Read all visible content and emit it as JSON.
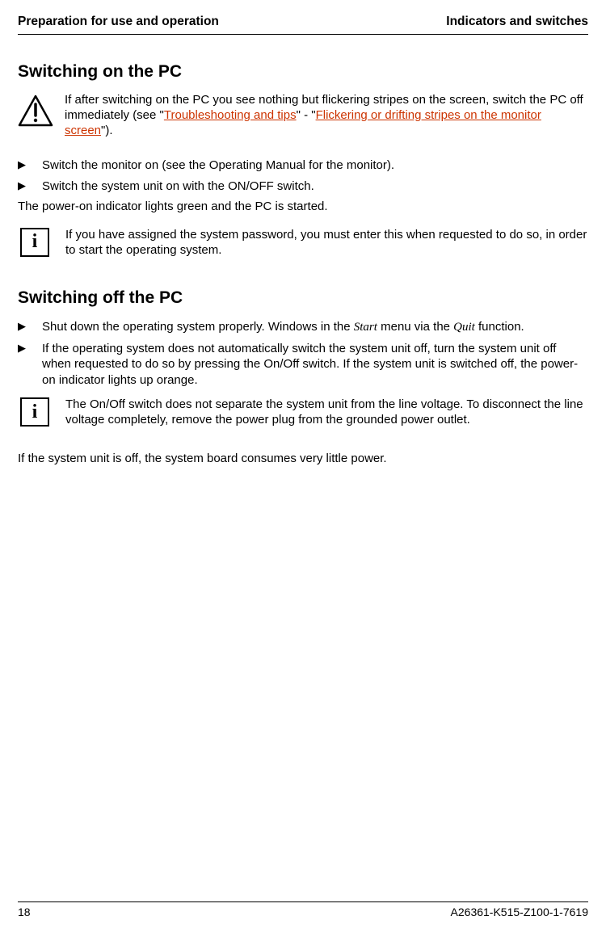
{
  "header": {
    "left": "Preparation for use and operation",
    "right": "Indicators and switches"
  },
  "section1": {
    "title": "Switching on the PC",
    "warning": {
      "pre": "If after switching on the PC you see nothing but flickering stripes on the screen, switch the PC off immediately (see \"",
      "link1": "Troubleshooting and tips",
      "mid": "\" - \"",
      "link2": "Flickering or drifting stripes on the monitor screen",
      "post": "\")."
    },
    "bullets": [
      "Switch the monitor on (see the Operating Manual for the monitor).",
      "Switch the system unit on with the ON/OFF switch."
    ],
    "para": "The power-on indicator lights green and the PC is started.",
    "info": "If you have assigned the system password, you must enter this when requested to do so, in order to start the operating system."
  },
  "section2": {
    "title": "Switching off the PC",
    "bullets": [
      {
        "pre": "Shut down the operating system properly. Windows in the ",
        "ital1": "Start",
        "mid": " menu via the ",
        "ital2": "Quit",
        "post": " function."
      },
      {
        "text": "If the operating system does not automatically switch the system unit off, turn the system unit off when requested to do so by pressing the On/Off switch. If the system unit is switched off, the power-on indicator lights up orange."
      }
    ],
    "info": "The On/Off switch does not separate the system unit from the line voltage. To disconnect the line voltage completely, remove the power plug from the grounded power outlet.",
    "para": "If the system unit is off, the system board consumes very little power."
  },
  "footer": {
    "page": "18",
    "docnum": "A26361-K515-Z100-1-7619"
  }
}
